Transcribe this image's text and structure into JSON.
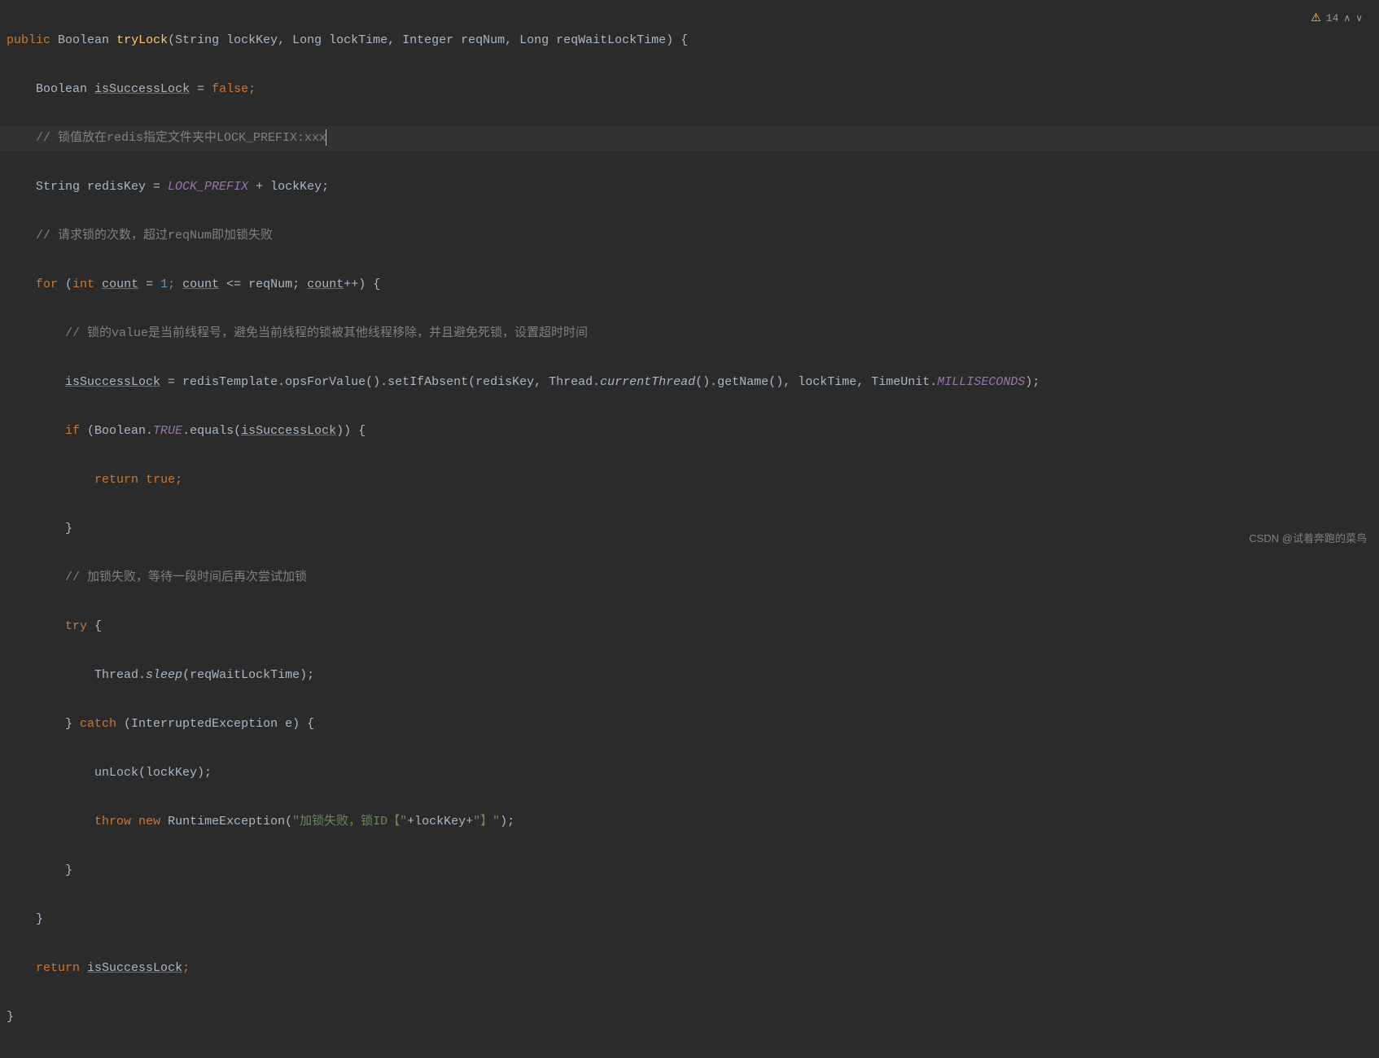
{
  "warning": {
    "count": "14"
  },
  "watermark": "CSDN @试着奔跑的菜鸟",
  "code": {
    "l1": {
      "public": "public",
      "boolean": "Boolean",
      "method": "tryLock",
      "sig": "(String lockKey, Long lockTime, Integer reqNum, Long reqWaitLockTime) {"
    },
    "l2": {
      "boolean": "Boolean",
      "var": "isSuccessLock",
      "eq": " = ",
      "false": "false",
      "semi": ";"
    },
    "l3": {
      "comment": "// 锁值放在redis指定文件夹中LOCK_PREFIX:xxx"
    },
    "l4": {
      "pre": "String redisKey = ",
      "const": "LOCK_PREFIX",
      "post": " + lockKey;"
    },
    "l5": {
      "comment": "// 请求锁的次数，超过reqNum即加锁失败"
    },
    "l6": {
      "for": "for",
      "p1": " (",
      "int": "int",
      "sp": " ",
      "count1": "count",
      "eq": " = ",
      "one": "1",
      "p2": "; ",
      "count2": "count",
      "le": " <= reqNum; ",
      "count3": "count",
      "inc": "++) {"
    },
    "l7": {
      "comment": "// 锁的value是当前线程号，避免当前线程的锁被其他线程移除，并且避免死锁，设置超时时间"
    },
    "l8": {
      "var": "isSuccessLock",
      "p1": " = redisTemplate.opsForValue().setIfAbsent(redisKey, Thread.",
      "cur": "currentThread",
      "p2": "().getName(), lockTime, TimeUnit.",
      "ms": "MILLISECONDS",
      "p3": ");"
    },
    "l9": {
      "if": "if",
      "p1": " (Boolean.",
      "true": "TRUE",
      "p2": ".equals(",
      "var": "isSuccessLock",
      "p3": ")) {"
    },
    "l10": {
      "return": "return",
      "sp": " ",
      "true": "true",
      "semi": ";"
    },
    "l11": {
      "brace": "}"
    },
    "l12": {
      "comment": "// 加锁失败，等待一段时间后再次尝试加锁"
    },
    "l13": {
      "try": "try",
      "brace": " {"
    },
    "l14": {
      "p1": "Thread.",
      "sleep": "sleep",
      "p2": "(reqWaitLockTime);"
    },
    "l15": {
      "brace": "} ",
      "catch": "catch",
      "p1": " (InterruptedException e) {"
    },
    "l16": {
      "call": "unLock(lockKey);"
    },
    "l17": {
      "throw": "throw",
      "sp": " ",
      "new": "new",
      "sp2": " ",
      "p1": "RuntimeException(",
      "s1": "\"加锁失败，锁ID【\"",
      "p2": "+lockKey+",
      "s2": "\"】\"",
      "p3": ");"
    },
    "l18": {
      "brace": "}"
    },
    "l19": {
      "brace": "}"
    },
    "l20": {
      "return": "return",
      "sp": " ",
      "var": "isSuccessLock",
      "semi": ";"
    },
    "l21": {
      "brace": "}"
    }
  }
}
